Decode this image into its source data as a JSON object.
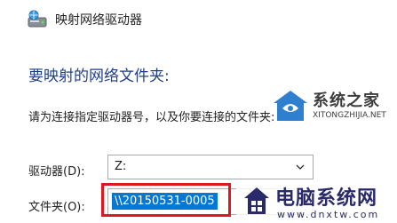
{
  "window": {
    "title": "映射网络驱动器",
    "icon": "network-drive-icon"
  },
  "content": {
    "heading": "要映射的网络文件夹:",
    "instruction": "请为连接指定驱动器号，以及你要连接的文件夹:"
  },
  "form": {
    "drive_label": "驱动器(D):",
    "drive_value": "Z:",
    "folder_label": "文件夹(O):",
    "folder_value": "\\\\20150531-0005"
  },
  "colors": {
    "heading": "#1f3f8a",
    "selection": "#0078d7",
    "highlight_box": "#e0171f"
  },
  "watermarks": {
    "xitongzhijia": {
      "name": "系统之家",
      "url": "XITONGZHIJIA.NET"
    },
    "dnxtw": {
      "name": "电脑系统网",
      "url": "www.dnxtw.com"
    }
  }
}
